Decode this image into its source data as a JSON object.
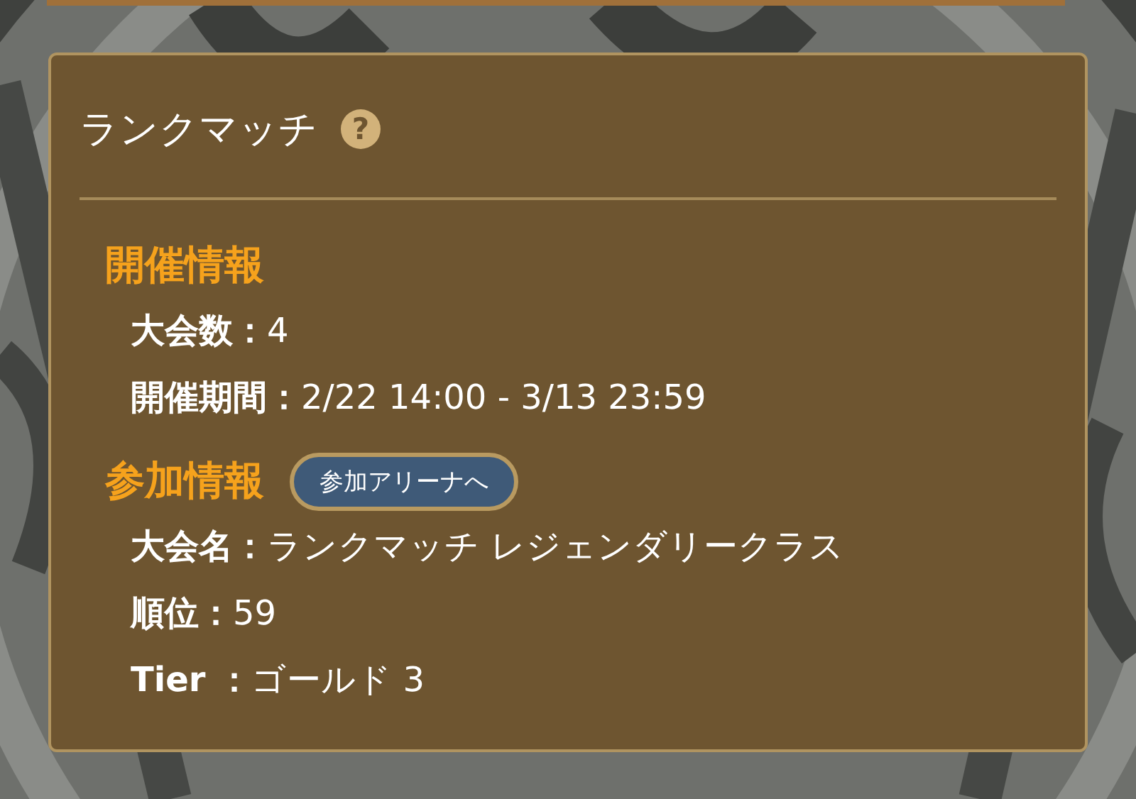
{
  "panel": {
    "title": "ランクマッチ",
    "help": "?"
  },
  "sections": [
    {
      "heading": "開催情報",
      "rows": [
        {
          "label": "大会数：",
          "value": "4"
        },
        {
          "label": "開催期間：",
          "value": "2/22 14:00 - 3/13 23:59"
        }
      ]
    },
    {
      "heading": "参加情報",
      "button": "参加アリーナへ",
      "rows": [
        {
          "label": "大会名：",
          "value": "ランクマッチ レジェンダリークラス"
        },
        {
          "label": "順位：",
          "value": "59"
        },
        {
          "label": "Tier ：",
          "value": "ゴールド 3"
        }
      ]
    }
  ]
}
